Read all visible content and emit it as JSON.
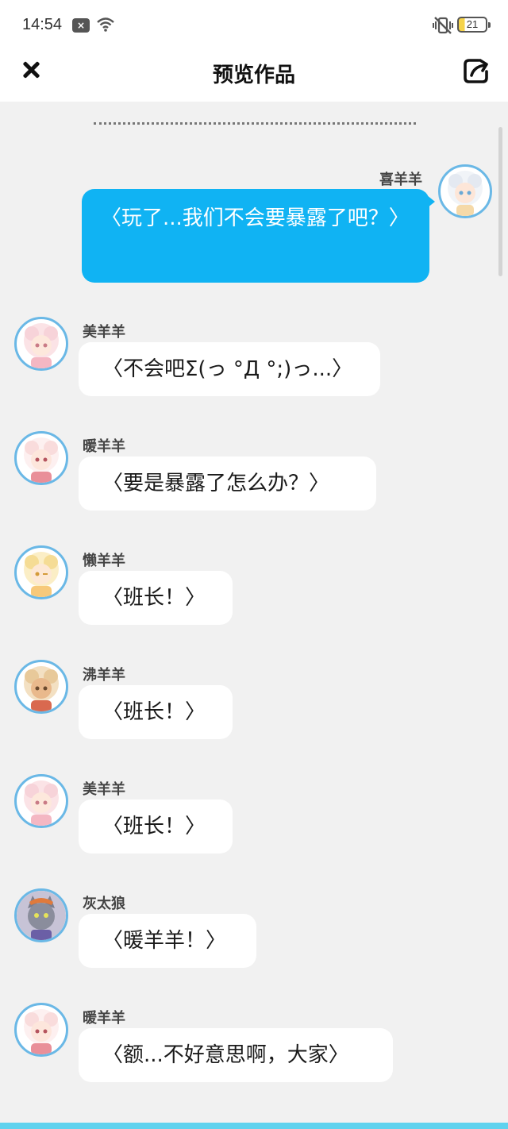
{
  "status_bar": {
    "time": "14:54",
    "notification_icon": "x-box-icon",
    "wifi_icon": "wifi-icon",
    "vibrate_icon": "vibrate-off-icon",
    "battery_level": "21"
  },
  "header": {
    "title": "预览作品",
    "close_icon": "close-icon",
    "share_icon": "share-icon"
  },
  "messages": [
    {
      "sender": "喜羊羊",
      "text": "〈玩了...我们不会要暴露了吧？〉",
      "side": "right"
    },
    {
      "sender": "美羊羊",
      "text": "〈不会吧Σ(っ °Д °;)っ...〉",
      "side": "left"
    },
    {
      "sender": "暖羊羊",
      "text": "〈要是暴露了怎么办？〉",
      "side": "left"
    },
    {
      "sender": "懒羊羊",
      "text": "〈班长！〉",
      "side": "left"
    },
    {
      "sender": "沸羊羊",
      "text": "〈班长！〉",
      "side": "left"
    },
    {
      "sender": "美羊羊",
      "text": "〈班长！〉",
      "side": "left"
    },
    {
      "sender": "灰太狼",
      "text": "〈暖羊羊！〉",
      "side": "left"
    },
    {
      "sender": "暖羊羊",
      "text": "〈额...不好意思啊，大家〉",
      "side": "left"
    }
  ],
  "colors": {
    "accent": "#10b3f3",
    "avatar_ring": "#6ab8e6",
    "background": "#f1f1f1"
  }
}
